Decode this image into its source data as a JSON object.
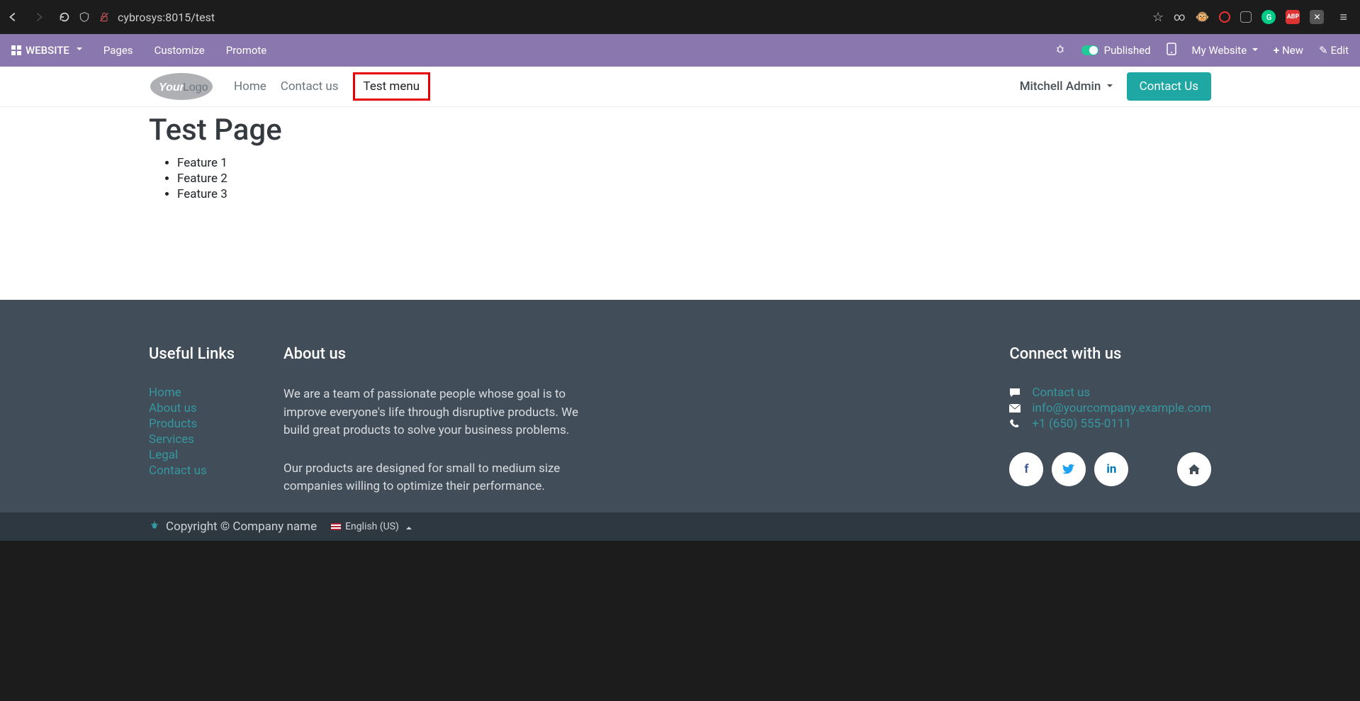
{
  "browser": {
    "url": "cybrosys:8015/test"
  },
  "admin_bar": {
    "app_label": "WEBSITE",
    "menu": [
      "Pages",
      "Customize",
      "Promote"
    ],
    "published_label": "Published",
    "my_website_label": "My Website",
    "new_label": "New",
    "edit_label": "Edit"
  },
  "site_header": {
    "nav": [
      {
        "label": "Home",
        "active": false
      },
      {
        "label": "Contact us",
        "active": false
      },
      {
        "label": "Test menu",
        "active": true,
        "highlight": true
      }
    ],
    "user_name": "Mitchell Admin",
    "contact_btn": "Contact Us"
  },
  "page": {
    "title": "Test Page",
    "features": [
      "Feature 1",
      "Feature 2",
      "Feature 3"
    ]
  },
  "footer": {
    "useful_links": {
      "title": "Useful Links",
      "links": [
        "Home",
        "About us",
        "Products",
        "Services",
        "Legal",
        "Contact us"
      ]
    },
    "about": {
      "title": "About us",
      "p1": "We are a team of passionate people whose goal is to improve everyone's life through disruptive products. We build great products to solve your business problems.",
      "p2": "Our products are designed for small to medium size companies willing to optimize their performance."
    },
    "connect": {
      "title": "Connect with us",
      "contact_link": "Contact us",
      "email": "info@yourcompany.example.com",
      "phone": "+1 (650) 555-0111"
    }
  },
  "bottom": {
    "copyright": "Copyright © Company name",
    "language": "English (US)"
  }
}
